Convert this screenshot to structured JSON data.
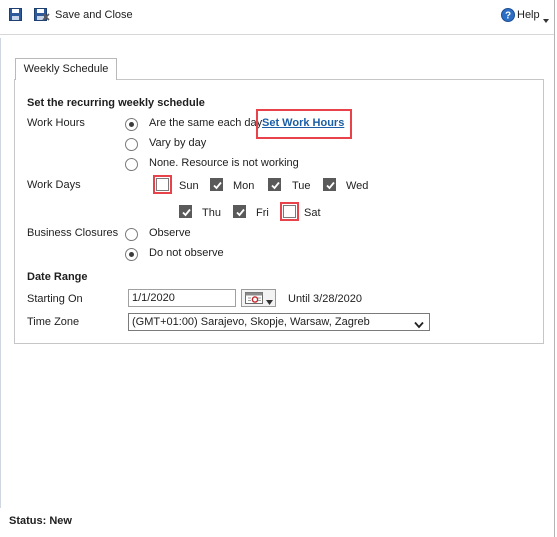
{
  "toolbar": {
    "save_close_label": "Save and Close",
    "help_label": "Help"
  },
  "tab": {
    "label": "Weekly Schedule"
  },
  "schedule": {
    "section_title": "Set the recurring weekly schedule",
    "work_hours": {
      "label": "Work Hours",
      "options": [
        {
          "label": "Are the same each day",
          "checked": true
        },
        {
          "label": "Vary by day",
          "checked": false
        },
        {
          "label": "None. Resource is not working",
          "checked": false
        }
      ],
      "set_link": "Set Work Hours"
    },
    "work_days": {
      "label": "Work Days",
      "days": [
        {
          "label": "Sun",
          "checked": false
        },
        {
          "label": "Mon",
          "checked": true
        },
        {
          "label": "Tue",
          "checked": true
        },
        {
          "label": "Wed",
          "checked": true
        },
        {
          "label": "Thu",
          "checked": true
        },
        {
          "label": "Fri",
          "checked": true
        },
        {
          "label": "Sat",
          "checked": false
        }
      ]
    },
    "business_closures": {
      "label": "Business Closures",
      "options": [
        {
          "label": "Observe",
          "checked": false
        },
        {
          "label": "Do not observe",
          "checked": true
        }
      ]
    }
  },
  "date_range": {
    "section_title": "Date Range",
    "starting_on_label": "Starting On",
    "starting_on_value": "1/1/2020",
    "until_text": "Until 3/28/2020",
    "time_zone_label": "Time Zone",
    "time_zone_value": "(GMT+01:00) Sarajevo, Skopje, Warsaw, Zagreb"
  },
  "status": {
    "text": "Status: New"
  },
  "colors": {
    "highlight": "#e8424b",
    "link": "#1b5ea6"
  }
}
